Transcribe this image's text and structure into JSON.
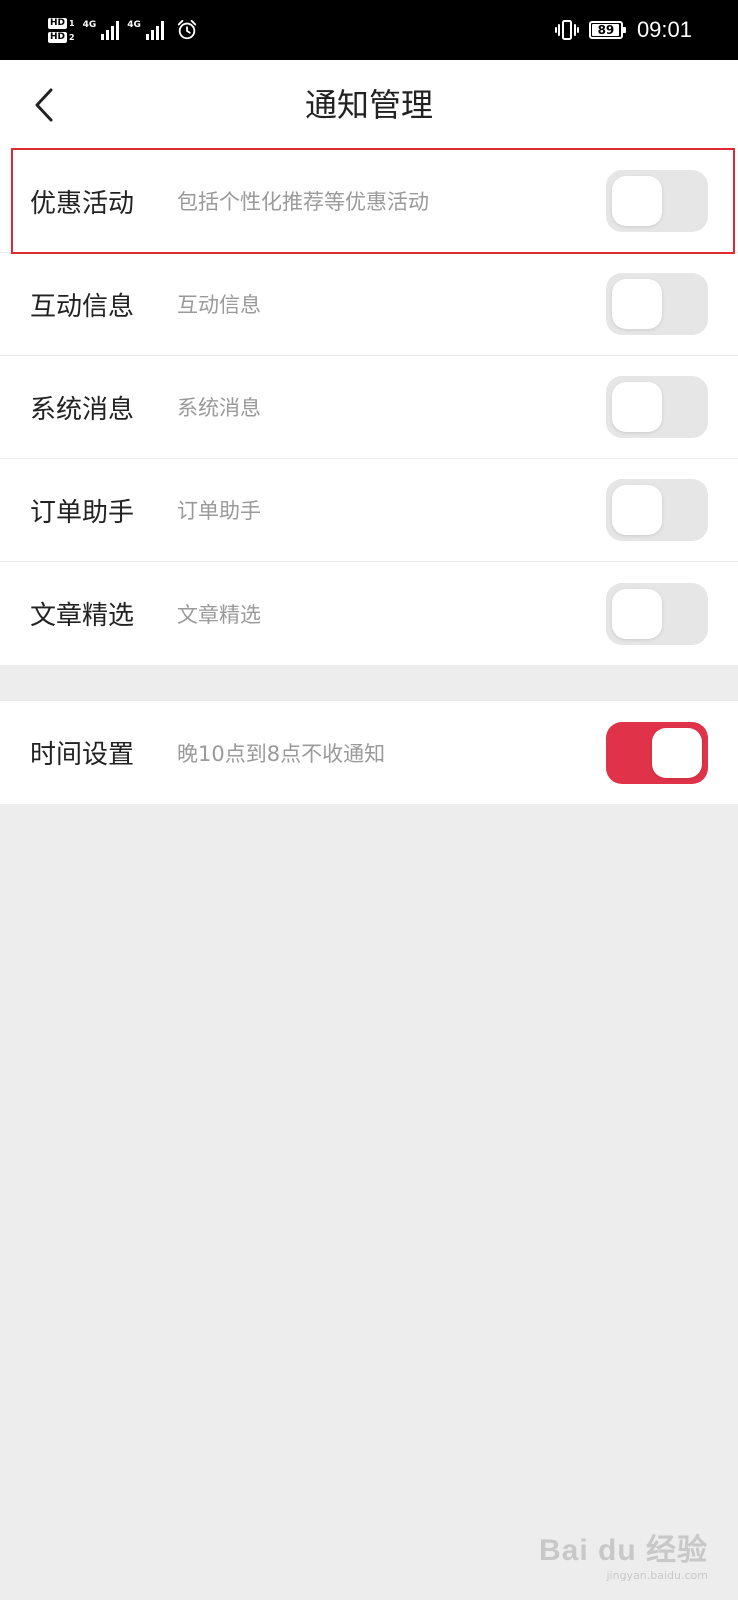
{
  "status_bar": {
    "sim1": "HD",
    "sim1_slot": "1",
    "sim2": "HD",
    "sim2_slot": "2",
    "network1": "4G",
    "network2": "4G",
    "battery": "89",
    "battery_level": 0.89,
    "time": "09:01",
    "icons": [
      "signal-bars-icon",
      "alarm-icon",
      "vibrate-icon",
      "battery-icon"
    ]
  },
  "header": {
    "title": "通知管理",
    "back_icon": "chevron-left-icon"
  },
  "notification_items": [
    {
      "title": "优惠活动",
      "desc": "包括个性化推荐等优惠活动",
      "enabled": false,
      "highlighted": true
    },
    {
      "title": "互动信息",
      "desc": "互动信息",
      "enabled": false
    },
    {
      "title": "系统消息",
      "desc": "系统消息",
      "enabled": false
    },
    {
      "title": "订单助手",
      "desc": "订单助手",
      "enabled": false
    },
    {
      "title": "文章精选",
      "desc": "文章精选",
      "enabled": false
    }
  ],
  "time_setting": {
    "title": "时间设置",
    "desc": "晚10点到8点不收通知",
    "enabled": true
  },
  "colors": {
    "accent": "#e0334a",
    "highlight_border": "#e02a33",
    "background": "#ededed"
  },
  "watermark": {
    "logo": "Bai du 经验",
    "url": "jingyan.baidu.com"
  }
}
